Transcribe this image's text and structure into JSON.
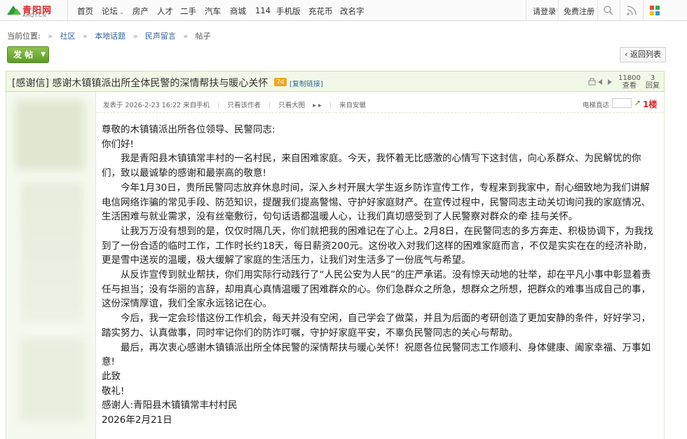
{
  "nav": {
    "logo_text": "青阳网",
    "logo_domain": "AHQY.CN",
    "items": [
      {
        "label": "首页",
        "caret": false
      },
      {
        "label": "论坛",
        "caret": true
      },
      {
        "label": "房产",
        "caret": false
      },
      {
        "label": "人才",
        "caret": false
      },
      {
        "label": "二手",
        "caret": false
      },
      {
        "label": "汽车",
        "caret": false
      },
      {
        "label": "商城",
        "caret": false
      },
      {
        "label": "114",
        "caret": false
      },
      {
        "label": "手机版",
        "caret": false
      },
      {
        "label": "充花币",
        "caret": false
      },
      {
        "label": "改名字",
        "caret": false
      }
    ],
    "login": "请登录",
    "register": "免费注册",
    "icons": [
      "search-icon",
      "rss-icon",
      "apps-icon"
    ]
  },
  "breadcrumb": {
    "prefix": "当前位置:",
    "items": [
      "社区",
      "本地话题",
      "民声留言",
      "帖子"
    ]
  },
  "actions": {
    "post_label": "发 帖",
    "back_label": "返回列表"
  },
  "thread": {
    "title": "[感谢信] 感谢木镇镇派出所全体民警的深情帮扶与暖心关怀",
    "badge": "7d",
    "copy_link": "[复制链接]",
    "views": "11800",
    "views_label": "查看",
    "replies": "3",
    "replies_label": "回复"
  },
  "post_meta": {
    "posted": "发表于 2026-2-23 16:22 来自手机",
    "only_author": "只看该作者",
    "only_big_image": "只看大图",
    "from": "来自安徽",
    "floor_label": "电梯直达",
    "floor": "1楼"
  },
  "content": {
    "greeting": "尊敬的木镇镇派出所各位领导、民警同志:",
    "hello": "你们好!",
    "paragraphs": [
      "我是青阳县木镇镇常丰村的一名村民，来自困难家庭。今天，我怀着无比感激的心情写下这封信，向心系群众、为民解忧的你们，致以最诚挚的感谢和最崇高的敬意!",
      "今年1月30日，贵所民警同志放弃休息时间，深入乡村开展大学生返乡防诈宣传工作，专程来到我家中，耐心细致地为我们讲解电信网络诈骗的常见手段、防范知识，提醒我们提高警惕、守护好家庭财产。在宣传过程中，民警同志主动关切询问我的家庭情况、生活困难与就业需求，没有丝毫敷衍，句句话语都温暖人心，让我们真切感受到了人民警察对群众的牵 挂与关怀。",
      "让我万万没有想到的是，仅仅时隔几天，你们就把我的困难记在了心上。2月8日，在民警同志的多方奔走、积极协调下，为我找到了一份合适的临时工作，工作时长约18天，每日薪资200元。这份收入对我们这样的困难家庭而言，不仅是实实在在的经济补助，更是雪中送炭的温暖，极大缓解了家庭的生活压力，让我们对生活多了一份底气与希望。",
      "从反诈宣传到就业帮扶，你们用实际行动践行了“人民公安为人民”的庄严承诺。没有惊天动地的壮举，却在平凡小事中彰显着责任与担当；没有华丽的言辞，却用真心真情温暖了困难群众的心。你们急群众之所急，想群众之所想，把群众的难事当成自己的事，这份深情厚谊，我们全家永远铭记在心。",
      "今后，我一定会珍惜这份工作机会，每天并没有空闲，自己学会了做菜，并且为后面的考研创造了更加安静的条件，好好学习，踏实努力、认真做事，同时牢记你们的防诈叮嘱，守护好家庭平安，不辜负民警同志的关心与帮助。",
      "最后，再次衷心感谢木镇镇派出所全体民警的深情帮扶与暖心关怀！祝愿各位民警同志工作顺利、身体健康、阖家幸福、万事如意!"
    ],
    "closing1": "此致",
    "closing2": "敬礼!",
    "signer": "感谢人:青阳县木镇镇常丰村村民",
    "date": "2026年2月21日"
  },
  "colors": {
    "brand_red": "#d8262b",
    "header_green_bg": "#f2f8e6",
    "post_button": "#6fae33"
  }
}
